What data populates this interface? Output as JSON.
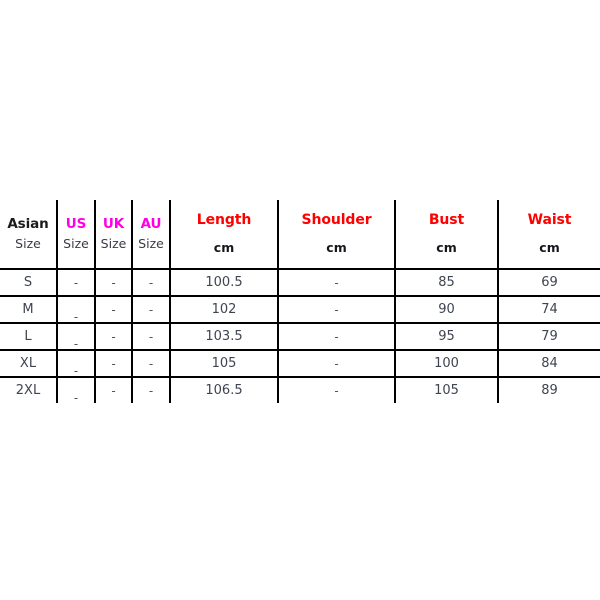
{
  "colors": {
    "header_red": "#ff0000",
    "header_magenta": "#ff00e4",
    "header_dark": "#1b1b1b",
    "body_text": "#3f4450",
    "rule": "#000000",
    "background": "#ffffff"
  },
  "table": {
    "columns": [
      {
        "key": "asian",
        "title": "Asian",
        "unit": "Size",
        "title_color": "#1b1b1b",
        "style": "dark"
      },
      {
        "key": "us",
        "title": "US",
        "unit": "Size",
        "title_color": "#ff00e4",
        "style": "magenta"
      },
      {
        "key": "uk",
        "title": "UK",
        "unit": "Size",
        "title_color": "#ff00e4",
        "style": "magenta"
      },
      {
        "key": "au",
        "title": "AU",
        "unit": "Size",
        "title_color": "#ff00e4",
        "style": "magenta"
      },
      {
        "key": "length",
        "title": "Length",
        "unit": "cm",
        "title_color": "#ff0000",
        "style": "red"
      },
      {
        "key": "shoulder",
        "title": "Shoulder",
        "unit": "cm",
        "title_color": "#ff0000",
        "style": "red"
      },
      {
        "key": "bust",
        "title": "Bust",
        "unit": "cm",
        "title_color": "#ff0000",
        "style": "red"
      },
      {
        "key": "waist",
        "title": "Waist",
        "unit": "cm",
        "title_color": "#ff0000",
        "style": "red"
      }
    ],
    "rows": [
      {
        "asian": "S",
        "us": "-",
        "uk": "-",
        "au": "-",
        "length": "100.5",
        "shoulder": "-",
        "bust": "85",
        "waist": "69"
      },
      {
        "asian": "M",
        "us": "-",
        "uk": "-",
        "au": "-",
        "length": "102",
        "shoulder": "-",
        "bust": "90",
        "waist": "74"
      },
      {
        "asian": "L",
        "us": "-",
        "uk": "-",
        "au": "-",
        "length": "103.5",
        "shoulder": "-",
        "bust": "95",
        "waist": "79"
      },
      {
        "asian": "XL",
        "us": "-",
        "uk": "-",
        "au": "-",
        "length": "105",
        "shoulder": "-",
        "bust": "100",
        "waist": "84"
      },
      {
        "asian": "2XL",
        "us": "-",
        "uk": "-",
        "au": "-",
        "length": "106.5",
        "shoulder": "-",
        "bust": "105",
        "waist": "89"
      }
    ]
  },
  "chart_data": {
    "type": "table",
    "title": "",
    "columns": [
      "Asian Size",
      "US Size",
      "UK Size",
      "AU Size",
      "Length cm",
      "Shoulder cm",
      "Bust cm",
      "Waist cm"
    ],
    "rows": [
      [
        "S",
        "-",
        "-",
        "-",
        "100.5",
        "-",
        "85",
        "69"
      ],
      [
        "M",
        "-",
        "-",
        "-",
        "102",
        "-",
        "90",
        "74"
      ],
      [
        "L",
        "-",
        "-",
        "-",
        "103.5",
        "-",
        "95",
        "79"
      ],
      [
        "XL",
        "-",
        "-",
        "-",
        "105",
        "-",
        "100",
        "84"
      ],
      [
        "2XL",
        "-",
        "-",
        "-",
        "106.5",
        "-",
        "105",
        "89"
      ]
    ],
    "units": {
      "length": "cm",
      "shoulder": "cm",
      "bust": "cm",
      "waist": "cm"
    },
    "series": [
      {
        "name": "Length",
        "categories": [
          "S",
          "M",
          "L",
          "XL",
          "2XL"
        ],
        "values": [
          100.5,
          102,
          103.5,
          105,
          106.5
        ]
      },
      {
        "name": "Bust",
        "categories": [
          "S",
          "M",
          "L",
          "XL",
          "2XL"
        ],
        "values": [
          85,
          90,
          95,
          100,
          105
        ]
      },
      {
        "name": "Waist",
        "categories": [
          "S",
          "M",
          "L",
          "XL",
          "2XL"
        ],
        "values": [
          69,
          74,
          79,
          84,
          89
        ]
      }
    ]
  }
}
